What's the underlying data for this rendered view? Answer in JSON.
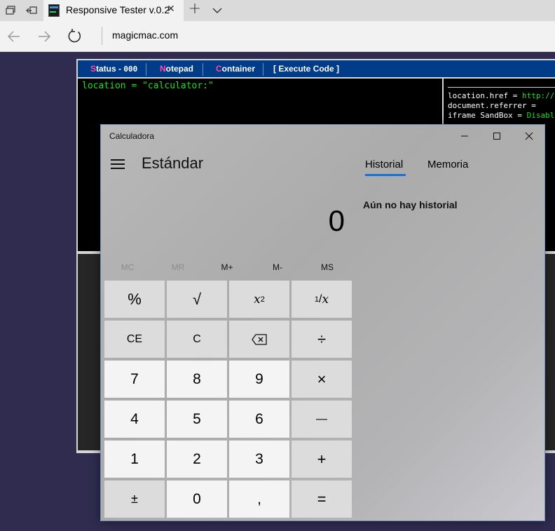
{
  "browser": {
    "tab_title": "Responsive Tester v.0.2",
    "tab_close": "✕",
    "new_tab": "+",
    "address": "magicmac.com"
  },
  "page": {
    "menu": [
      {
        "accent": "S",
        "rest": "tatus - ",
        "extra": "000"
      },
      {
        "accent": "N",
        "rest": "otepad"
      },
      {
        "accent": "C",
        "rest": "ontainer"
      },
      {
        "label": "[ Execute Code ]"
      }
    ],
    "code": "location = \"calculator:\"",
    "info_lines": [
      {
        "key": "location.href = ",
        "value": "http://"
      },
      {
        "key": "document.referrer = ",
        "value": ""
      },
      {
        "key": "iframe SandBox = ",
        "value": "Disabl"
      }
    ]
  },
  "calculator": {
    "window_title": "Calculadora",
    "mode": "Estándar",
    "display": "0",
    "memory_keys": [
      {
        "label": "MC",
        "enabled": false
      },
      {
        "label": "MR",
        "enabled": false
      },
      {
        "label": "M+",
        "enabled": true
      },
      {
        "label": "M-",
        "enabled": true
      },
      {
        "label": "MS",
        "enabled": true
      }
    ],
    "keys": {
      "percent": "%",
      "sqrt": "√",
      "square_base": "x",
      "square_exp": "2",
      "reciprocal_num": "1",
      "reciprocal_den": "x",
      "ce": "CE",
      "c": "C",
      "divide": "÷",
      "seven": "7",
      "eight": "8",
      "nine": "9",
      "multiply": "×",
      "four": "4",
      "five": "5",
      "six": "6",
      "minus": "—",
      "one": "1",
      "two": "2",
      "three": "3",
      "plus": "+",
      "negate": "±",
      "zero": "0",
      "decimal": ",",
      "equals": "="
    },
    "tabs": {
      "history": "Historial",
      "memory": "Memoria"
    },
    "history_empty": "Aún no hay historial",
    "accent_color": "#1a6fd6"
  }
}
